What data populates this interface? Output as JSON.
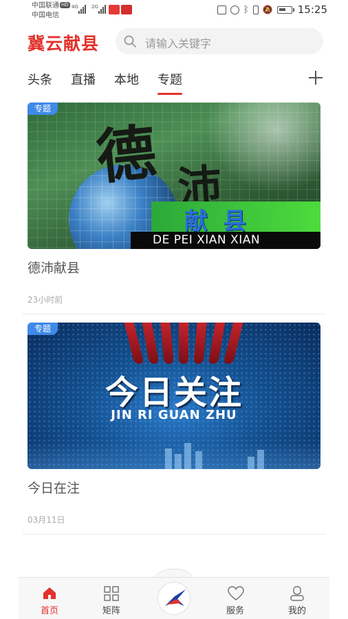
{
  "status_bar": {
    "carrier1": "中国联通",
    "carrier2": "中国电信",
    "hd": "HD",
    "net1": "4G",
    "net2": "2G",
    "time": "15:25"
  },
  "header": {
    "logo": "冀云献县",
    "search_placeholder": "请输入关键字",
    "brand_color": "#e3312b"
  },
  "tabs": [
    {
      "label": "头条"
    },
    {
      "label": "直播"
    },
    {
      "label": "本地"
    },
    {
      "label": "专题",
      "active": true
    }
  ],
  "cards": [
    {
      "tag": "专题",
      "title": "德沛献县",
      "time": "23小时前",
      "image": {
        "char1": "德",
        "char2": "沛",
        "band_text": "献县",
        "pinyin": "DE PEI XIAN XIAN"
      }
    },
    {
      "tag": "专题",
      "title": "今日在注",
      "time": "03月11日",
      "image": {
        "main": "今日关注",
        "sub": "JIN RI GUAN ZHU"
      }
    }
  ],
  "bottom_nav": [
    {
      "label": "首页",
      "icon": "home-icon",
      "active": true
    },
    {
      "label": "矩阵",
      "icon": "grid-icon"
    },
    {
      "label": "",
      "icon": "app-logo-icon"
    },
    {
      "label": "服务",
      "icon": "heart-icon"
    },
    {
      "label": "我的",
      "icon": "user-icon"
    }
  ]
}
